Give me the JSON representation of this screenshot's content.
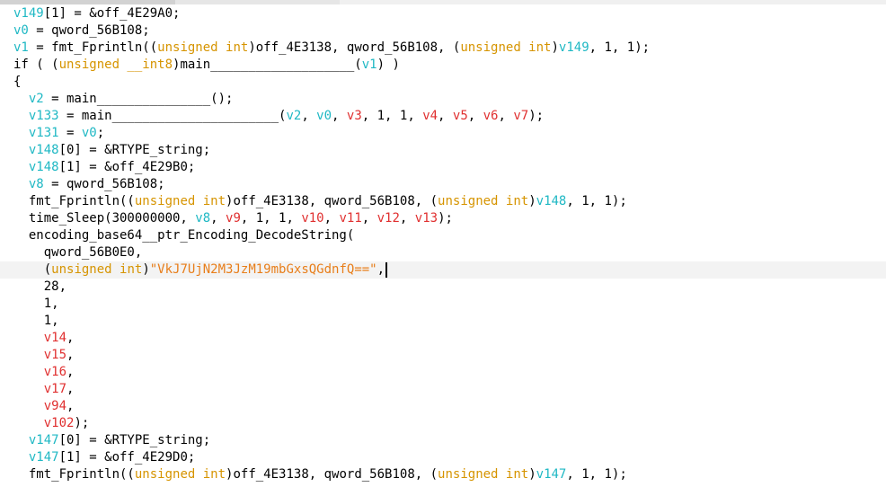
{
  "code": {
    "tokens": {
      "v149": "v149",
      "v148": "v148",
      "v147": "v147",
      "v0": "v0",
      "v1": "v1",
      "v2": "v2",
      "v3": "v3",
      "v4": "v4",
      "v5": "v5",
      "v6": "v6",
      "v7": "v7",
      "v8": "v8",
      "v9": "v9",
      "v10": "v10",
      "v11": "v11",
      "v12": "v12",
      "v13": "v13",
      "v14": "v14",
      "v15": "v15",
      "v16": "v16",
      "v17": "v17",
      "v94": "v94",
      "v102": "v102",
      "v131": "v131",
      "v133": "v133",
      "unsigned_int": "unsigned int",
      "unsigned_int8": "unsigned __int8",
      "base64_literal": "\"VkJ7UjN2M3JzM19mbGxsQGdnfQ==\""
    },
    "text": {
      "l1a": "[1] = &off_4E29A0;",
      "l2a": " = qword_56B108;",
      "l3a": " = fmt_Fprintln((",
      "l3b": ")off_4E3138, qword_56B108, (",
      "l3c": ", 1, 1);",
      "l4a": "if ( (",
      "l4b": ")main___________________(",
      "l4c": ") )",
      "l5": "{",
      "l6a": " = main_______________();",
      "l7a": " = main______________________(",
      "l8a": " = ",
      "l8b": ";",
      "l9a": "[0] = &RTYPE_string;",
      "l10a": "[1] = &off_4E29B0;",
      "l11a": " = qword_56B108;",
      "l12a": "fmt_Fprintln((",
      "l13a": "time_Sleep(300000000, ",
      "l14": "encoding_base64__ptr_Encoding_DecodeString(",
      "l15": "qword_56B0E0,",
      "l16a": "(",
      "l16b": ")",
      "l16c": ",",
      "n28": "28,",
      "n1": "1,",
      "v102close": ");",
      "l25a": "[0] = &RTYPE_string;",
      "l26a": "[1] = &off_4E29D0;",
      "paren_open": "(",
      "comma": ", ",
      "comma_only": ",",
      "close_paren_semicolon": ");",
      "one_one_close": ", 1, 1);",
      "one_one": ", 1, 1, "
    },
    "colors": {
      "local_var": "#1fb8c4",
      "arg_var": "#e03030",
      "type": "#d69400",
      "string": "#e87e1a"
    }
  }
}
